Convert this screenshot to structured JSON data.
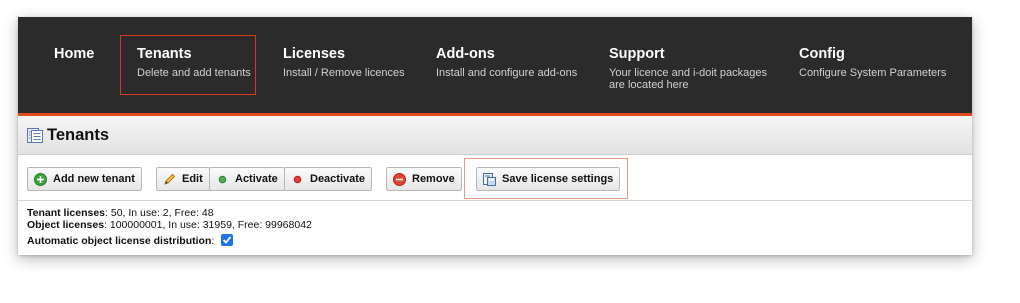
{
  "nav": {
    "items": [
      {
        "title": "Home",
        "subtitle": ""
      },
      {
        "title": "Tenants",
        "subtitle": "Delete and add tenants"
      },
      {
        "title": "Licenses",
        "subtitle": "Install / Remove licences"
      },
      {
        "title": "Add-ons",
        "subtitle": "Install and configure add-ons"
      },
      {
        "title": "Support",
        "subtitle": "Your licence and i-doit packages",
        "subtitle2": "are located here"
      },
      {
        "title": "Config",
        "subtitle": "Configure System Parameters"
      }
    ]
  },
  "page": {
    "title": "Tenants",
    "icon": "document-list-icon"
  },
  "toolbar": {
    "add_new_tenant": "Add new tenant",
    "edit": "Edit",
    "activate": "Activate",
    "deactivate": "Deactivate",
    "remove": "Remove",
    "save_license_settings": "Save license settings"
  },
  "info": {
    "tenant_label": "Tenant licenses",
    "tenant_value": ": 50, In use: 2, Free: 48",
    "object_label": "Object licenses",
    "object_value": ": 100000001, In use: 31959, Free: 99968042",
    "auto_label": "Automatic object license distribution",
    "auto_suffix": ":",
    "auto_checked": true
  },
  "colors": {
    "nav_bg": "#2b2b2b",
    "accent": "#e04a1f",
    "highlight_border": "#d33a1e",
    "checkbox": "#1a73e8"
  }
}
